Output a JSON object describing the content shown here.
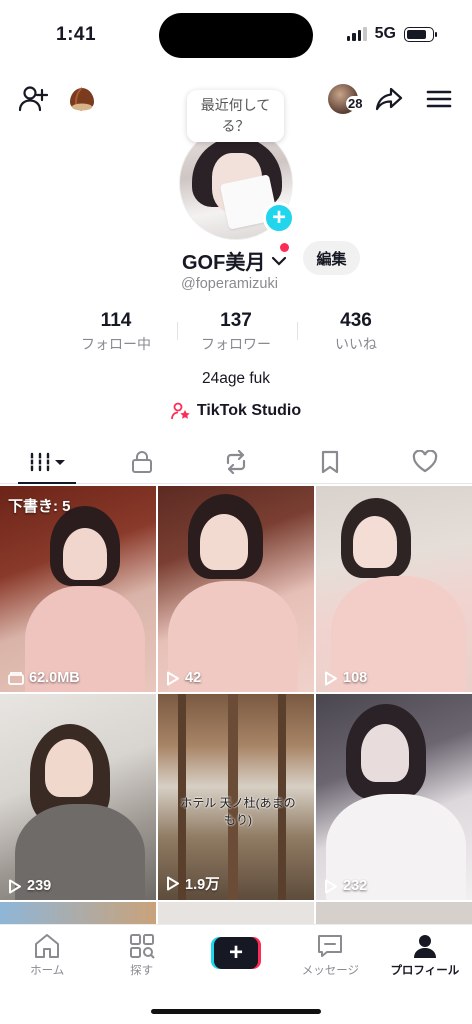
{
  "status_bar": {
    "time": "1:41",
    "network": "5G"
  },
  "header": {
    "bubble_text": "最近何してる？",
    "friends_count": "28"
  },
  "profile": {
    "username": "GOF美月",
    "handle": "@foperamizuki",
    "edit_label": "編集",
    "bio": "24age fuk",
    "studio_label": "TikTok Studio"
  },
  "stats": [
    {
      "value": "114",
      "label": "フォロー中"
    },
    {
      "value": "137",
      "label": "フォロワー"
    },
    {
      "value": "436",
      "label": "いいね"
    }
  ],
  "tabs": [
    "videos",
    "private",
    "reposts",
    "favorites",
    "liked"
  ],
  "videos": [
    {
      "label": "62.0MB",
      "kind": "draft",
      "draft_label": "下書き: 5"
    },
    {
      "label": "42",
      "kind": "play"
    },
    {
      "label": "108",
      "kind": "play"
    },
    {
      "label": "239",
      "kind": "play"
    },
    {
      "label": "1.9万",
      "kind": "play",
      "overlay": "ホテル 天ノ杜(あまのもり)"
    },
    {
      "label": "232",
      "kind": "play"
    }
  ],
  "bottom_nav": [
    {
      "label": "ホーム",
      "icon": "home-icon"
    },
    {
      "label": "探す",
      "icon": "discover-icon"
    },
    {
      "label": "",
      "icon": "create-plus-icon"
    },
    {
      "label": "メッセージ",
      "icon": "inbox-icon"
    },
    {
      "label": "プロフィール",
      "icon": "profile-icon",
      "active": true
    }
  ],
  "colors": {
    "accent_cyan": "#20d5ec",
    "accent_red": "#fe2c55",
    "text": "#161823",
    "muted": "#8a8b91"
  }
}
